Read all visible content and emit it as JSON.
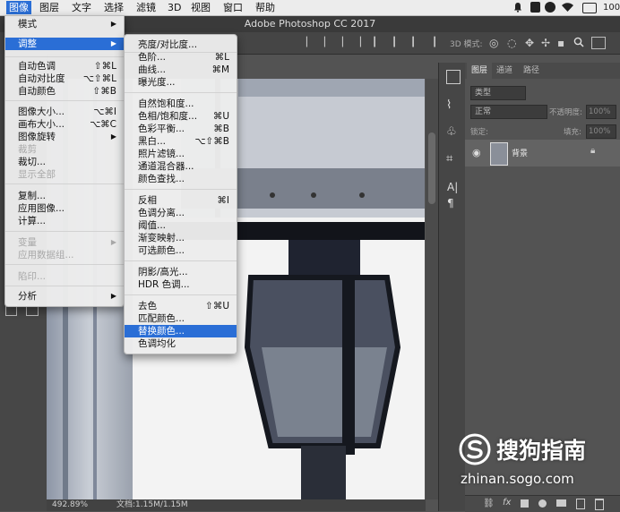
{
  "menubar": {
    "items": [
      "图像",
      "图层",
      "文字",
      "选择",
      "滤镜",
      "3D",
      "视图",
      "窗口",
      "帮助"
    ],
    "active_index": 0,
    "battery": "100"
  },
  "window_title": "Adobe Photoshop CC 2017",
  "optbar": {
    "mode_label": "3D 模式:"
  },
  "image_menu": {
    "items": [
      {
        "label": "模式",
        "shortcut": "",
        "submenu": true,
        "disabled": false
      },
      {
        "label": "调整",
        "shortcut": "",
        "submenu": true,
        "disabled": false,
        "highlighted": true
      },
      {
        "label": "自动色调",
        "shortcut": "⇧⌘L",
        "submenu": false,
        "disabled": false
      },
      {
        "label": "自动对比度",
        "shortcut": "⌥⇧⌘L",
        "submenu": false,
        "disabled": false
      },
      {
        "label": "自动颜色",
        "shortcut": "⇧⌘B",
        "submenu": false,
        "disabled": false
      },
      {
        "label": "图像大小...",
        "shortcut": "⌥⌘I",
        "submenu": false,
        "disabled": false
      },
      {
        "label": "画布大小...",
        "shortcut": "⌥⌘C",
        "submenu": false,
        "disabled": false
      },
      {
        "label": "图像旋转",
        "shortcut": "",
        "submenu": true,
        "disabled": false
      },
      {
        "label": "裁剪",
        "shortcut": "",
        "submenu": false,
        "disabled": true
      },
      {
        "label": "裁切...",
        "shortcut": "",
        "submenu": false,
        "disabled": false
      },
      {
        "label": "显示全部",
        "shortcut": "",
        "submenu": false,
        "disabled": true
      },
      {
        "label": "复制...",
        "shortcut": "",
        "submenu": false,
        "disabled": false
      },
      {
        "label": "应用图像...",
        "shortcut": "",
        "submenu": false,
        "disabled": false
      },
      {
        "label": "计算...",
        "shortcut": "",
        "submenu": false,
        "disabled": false
      },
      {
        "label": "变量",
        "shortcut": "",
        "submenu": true,
        "disabled": true
      },
      {
        "label": "应用数据组...",
        "shortcut": "",
        "submenu": false,
        "disabled": true
      },
      {
        "label": "陷印...",
        "shortcut": "",
        "submenu": false,
        "disabled": true
      },
      {
        "label": "分析",
        "shortcut": "",
        "submenu": true,
        "disabled": false
      }
    ]
  },
  "adjust_menu": {
    "items": [
      {
        "label": "亮度/对比度...",
        "shortcut": ""
      },
      {
        "label": "色阶...",
        "shortcut": "⌘L"
      },
      {
        "label": "曲线...",
        "shortcut": "⌘M"
      },
      {
        "label": "曝光度...",
        "shortcut": ""
      },
      {
        "label": "自然饱和度...",
        "shortcut": ""
      },
      {
        "label": "色相/饱和度...",
        "shortcut": "⌘U"
      },
      {
        "label": "色彩平衡...",
        "shortcut": "⌘B"
      },
      {
        "label": "黑白...",
        "shortcut": "⌥⇧⌘B"
      },
      {
        "label": "照片滤镜...",
        "shortcut": ""
      },
      {
        "label": "通道混合器...",
        "shortcut": ""
      },
      {
        "label": "颜色查找...",
        "shortcut": ""
      },
      {
        "label": "反相",
        "shortcut": "⌘I"
      },
      {
        "label": "色调分离...",
        "shortcut": ""
      },
      {
        "label": "阈值...",
        "shortcut": ""
      },
      {
        "label": "渐变映射...",
        "shortcut": ""
      },
      {
        "label": "可选颜色...",
        "shortcut": ""
      },
      {
        "label": "阴影/高光...",
        "shortcut": ""
      },
      {
        "label": "HDR 色调...",
        "shortcut": ""
      },
      {
        "label": "去色",
        "shortcut": "⇧⌘U"
      },
      {
        "label": "匹配颜色...",
        "shortcut": ""
      },
      {
        "label": "替换颜色...",
        "shortcut": "",
        "highlighted": true
      },
      {
        "label": "色调均化",
        "shortcut": ""
      }
    ]
  },
  "layers_panel": {
    "tabs": [
      "图层",
      "通道",
      "路径"
    ],
    "filter_kind": "类型",
    "blend_mode": "正常",
    "opacity_label": "不透明度:",
    "opacity_value": "100%",
    "lock_label": "锁定:",
    "fill_label": "填充:",
    "fill_value": "100%",
    "layer_name": "背景"
  },
  "status": {
    "zoom": "492.89%",
    "doc": "文档:1.15M/1.15M"
  },
  "watermark": {
    "brand": "搜狗指南",
    "url": "zhinan.sogo.com"
  }
}
